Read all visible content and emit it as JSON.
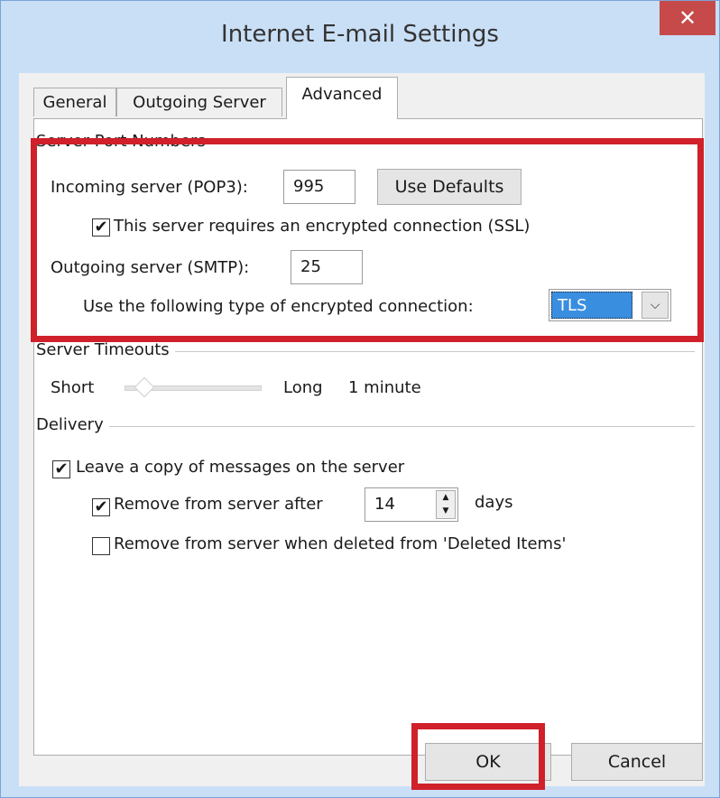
{
  "window": {
    "title": "Internet E-mail Settings",
    "close_glyph": "✕"
  },
  "tabs": [
    {
      "label": "General",
      "active": false
    },
    {
      "label": "Outgoing Server",
      "active": false
    },
    {
      "label": "Advanced",
      "active": true
    }
  ],
  "ports": {
    "group_label": "Server Port Numbers",
    "incoming_label": "Incoming server (POP3):",
    "incoming_value": "995",
    "use_defaults_label": "Use Defaults",
    "ssl_checkbox_label": "This server requires an encrypted connection (SSL)",
    "ssl_checked": true,
    "outgoing_label": "Outgoing server (SMTP):",
    "outgoing_value": "25",
    "encryption_label": "Use the following type of encrypted connection:",
    "encryption_value": "TLS"
  },
  "timeouts": {
    "group_label": "Server Timeouts",
    "short_label": "Short",
    "long_label": "Long",
    "value_label": "1 minute",
    "slider_level": 0.05
  },
  "delivery": {
    "group_label": "Delivery",
    "leave_copy_label": "Leave a copy of messages on the server",
    "leave_copy_checked": true,
    "remove_after_label": "Remove from server after",
    "remove_after_checked": true,
    "remove_after_days": "14",
    "days_label": "days",
    "remove_deleted_label": "Remove from server when deleted from 'Deleted Items'",
    "remove_deleted_checked": false
  },
  "footer": {
    "ok_label": "OK",
    "cancel_label": "Cancel"
  },
  "icons": {
    "checkmark": "✔",
    "dropdown_arrow": "⌵",
    "spin_up": "▲",
    "spin_down": "▼"
  },
  "colors": {
    "highlight": "#d0202a",
    "title_bar_bg": "#c9dff6",
    "close_button_bg": "#c74a4a",
    "selection_bg": "#3a8ee0"
  }
}
